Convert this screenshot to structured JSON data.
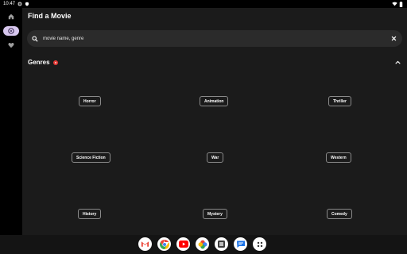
{
  "status_bar": {
    "time": "10:47",
    "icons": [
      "gear-icon",
      "shield-icon",
      "wifi-icon",
      "battery-icon"
    ]
  },
  "nav_rail": {
    "items": [
      {
        "name": "home",
        "icon": "home-icon",
        "active": false
      },
      {
        "name": "discover",
        "icon": "disc-icon",
        "active": true
      },
      {
        "name": "favorites",
        "icon": "heart-icon",
        "active": false
      }
    ]
  },
  "page": {
    "title": "Find a Movie"
  },
  "search": {
    "value": "movie name, genre",
    "search_icon": "search-icon",
    "clear_icon": "close-icon"
  },
  "genres": {
    "title": "Genres",
    "badge_color": "#e53935",
    "collapse_icon": "chevron-up-icon",
    "items": [
      "Horror",
      "Animation",
      "Thriller",
      "Science Fiction",
      "War",
      "Western",
      "History",
      "Mystery",
      "Comedy"
    ]
  },
  "taskbar": {
    "apps": [
      "gmail-icon",
      "chrome-icon",
      "youtube-icon",
      "photos-icon",
      "files-icon",
      "messages-icon",
      "app-drawer-icon"
    ]
  }
}
